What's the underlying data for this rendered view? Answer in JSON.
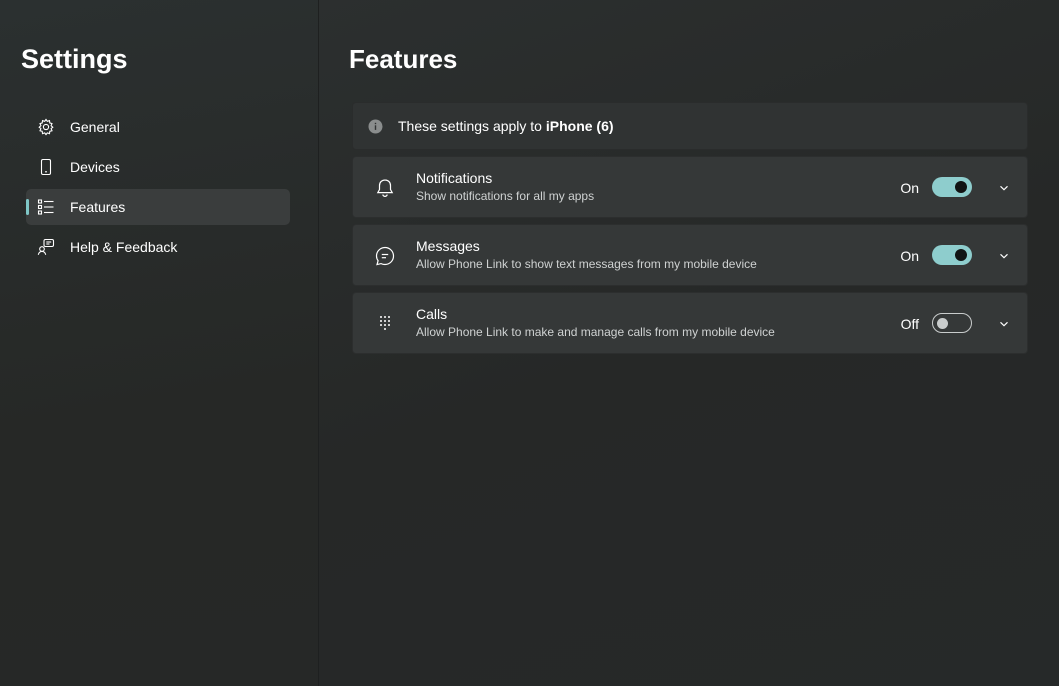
{
  "sidebar": {
    "title": "Settings",
    "items": [
      {
        "label": "General",
        "icon": "gear-icon",
        "active": false
      },
      {
        "label": "Devices",
        "icon": "phone-icon",
        "active": false
      },
      {
        "label": "Features",
        "icon": "list-icon",
        "active": true
      },
      {
        "label": "Help & Feedback",
        "icon": "help-feedback-icon",
        "active": false
      }
    ]
  },
  "main": {
    "title": "Features",
    "info": {
      "prefix": "These settings apply to ",
      "device": "iPhone (6)"
    },
    "features": [
      {
        "title": "Notifications",
        "description": "Show notifications for all my apps",
        "state": "On",
        "enabled": true,
        "icon": "bell-icon"
      },
      {
        "title": "Messages",
        "description": "Allow Phone Link to show text messages from my mobile device",
        "state": "On",
        "enabled": true,
        "icon": "chat-bubble-icon"
      },
      {
        "title": "Calls",
        "description": "Allow Phone Link to make and manage calls from my mobile device",
        "state": "Off",
        "enabled": false,
        "icon": "dialpad-icon"
      }
    ]
  },
  "colors": {
    "accent": "#8ecdcd",
    "background": "#272a2a",
    "card": "#353838"
  }
}
